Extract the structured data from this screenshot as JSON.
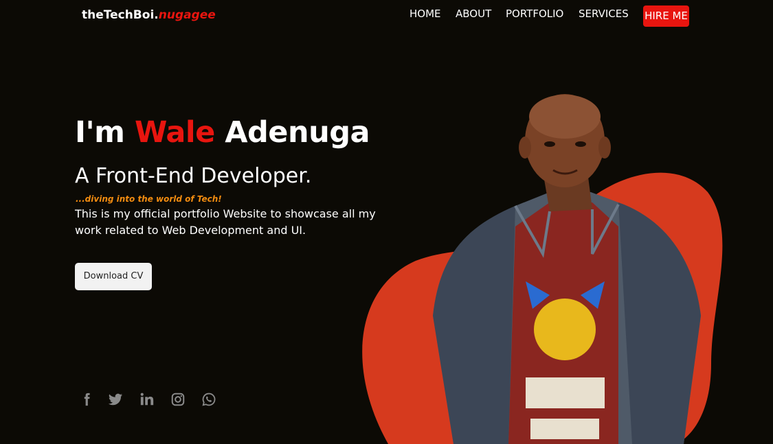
{
  "brand": {
    "name": "theTechBoi.",
    "accent": "nugagee"
  },
  "nav": {
    "items": [
      {
        "label": "HOME"
      },
      {
        "label": "ABOUT"
      },
      {
        "label": "PORTFOLIO"
      },
      {
        "label": "SERVICES"
      }
    ],
    "hire_label": "HIRE ME"
  },
  "hero": {
    "title_prefix": "I'm ",
    "title_first": "Wale",
    "title_last": " Adenuga",
    "subtitle": "A Front-End Developer.",
    "tagline": "...diving into the world of Tech!",
    "description": "This is my official portfolio Website to showcase all my work related to Web Development and UI.",
    "cta_label": "Download CV"
  },
  "social": [
    {
      "icon": "facebook-icon"
    },
    {
      "icon": "twitter-icon"
    },
    {
      "icon": "linkedin-icon"
    },
    {
      "icon": "instagram-icon"
    },
    {
      "icon": "whatsapp-icon"
    }
  ],
  "colors": {
    "background": "#0c0a05",
    "accent": "#e8150f",
    "tagline": "#f28c10",
    "blob": "#d63a1e",
    "icon_gray": "#8a8a8a"
  }
}
